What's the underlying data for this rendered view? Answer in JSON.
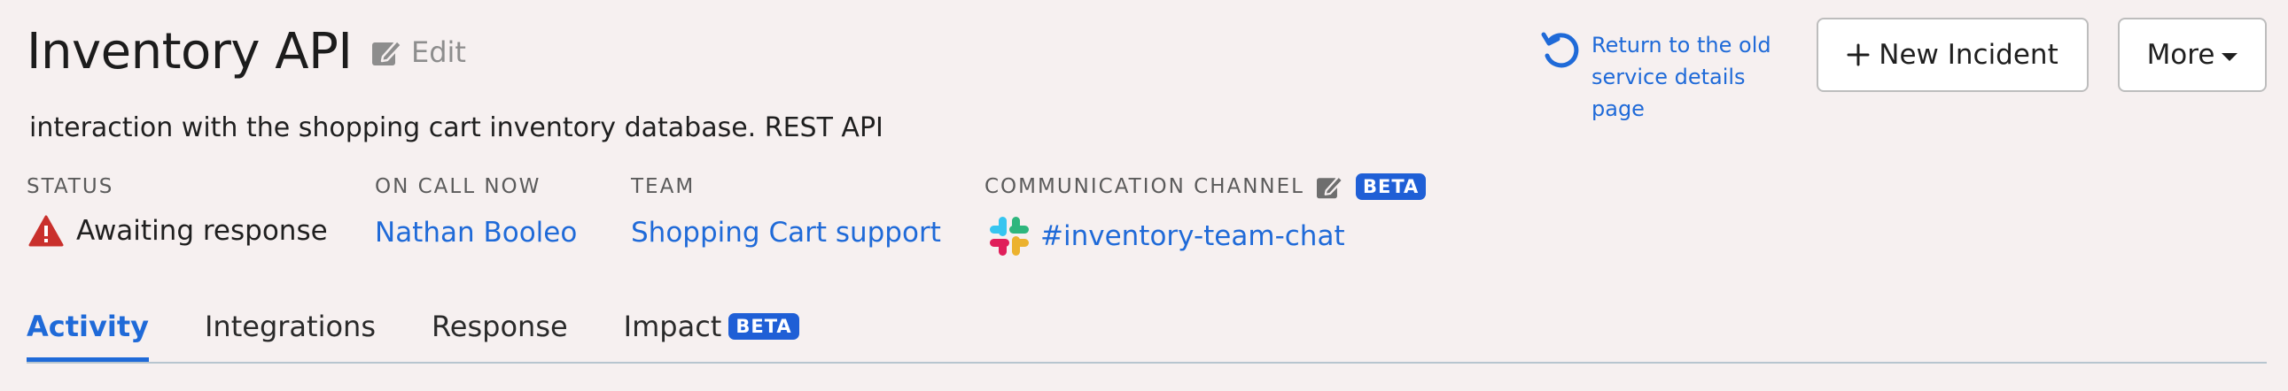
{
  "header": {
    "title": "Inventory API",
    "edit_label": "Edit",
    "description": "interaction with the shopping cart inventory database. REST API"
  },
  "return_link": {
    "line1": "Return to the old",
    "line2": "service details page"
  },
  "buttons": {
    "new_incident": "New Incident",
    "more": "More"
  },
  "details": {
    "status": {
      "label": "STATUS",
      "value": "Awaiting response"
    },
    "on_call": {
      "label": "ON CALL NOW",
      "value": "Nathan Booleo"
    },
    "team": {
      "label": "TEAM",
      "value": "Shopping Cart support"
    },
    "communication": {
      "label": "COMMUNICATION CHANNEL",
      "badge": "BETA",
      "value": "#inventory-team-chat"
    }
  },
  "tabs": [
    {
      "label": "Activity",
      "active": true
    },
    {
      "label": "Integrations",
      "active": false
    },
    {
      "label": "Response",
      "active": false
    },
    {
      "label": "Impact",
      "active": false,
      "badge": "BETA"
    }
  ],
  "colors": {
    "link": "#1f6ad8",
    "beta_badge": "#1f5fd6",
    "warning": "#c9302c",
    "background": "#f6f0f0"
  },
  "icons": {
    "edit": "pencil-square-icon",
    "warning": "warning-triangle-icon",
    "slack": "slack-icon",
    "return": "refresh-icon",
    "plus": "plus-icon",
    "caret": "caret-down-icon"
  }
}
